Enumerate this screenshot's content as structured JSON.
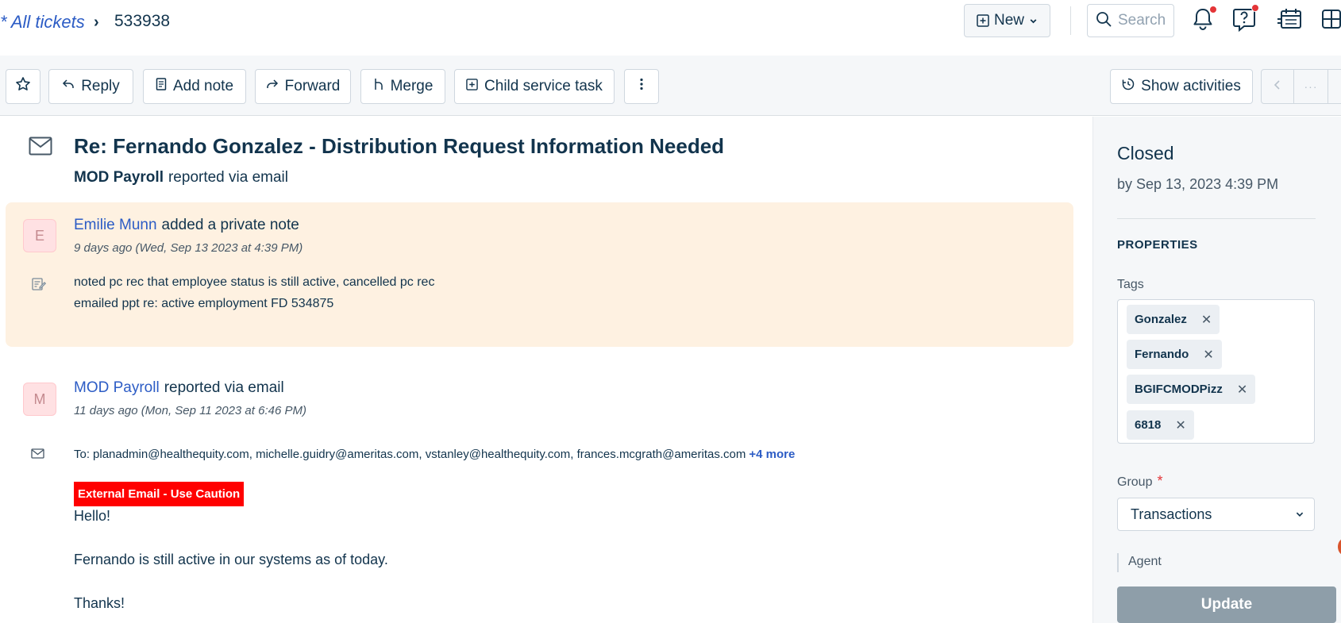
{
  "breadcrumb": {
    "all_tickets": "* All tickets",
    "separator": "›",
    "ticket_id": "533938"
  },
  "header": {
    "new_label": "New",
    "search_placeholder": "Search",
    "icons": [
      "plus-square-icon",
      "chevron-down-icon",
      "search-icon",
      "bell-icon",
      "help-icon",
      "calendar-icon",
      "apps-icon"
    ]
  },
  "toolbar": {
    "star_icon": "star-icon",
    "reply": "Reply",
    "add_note": "Add note",
    "forward": "Forward",
    "merge": "Merge",
    "child_task": "Child service task",
    "more_icon": "more-vertical-icon",
    "show_activities": "Show activities",
    "prev_icon": "chevron-left-icon",
    "ellipsis": "···"
  },
  "ticket": {
    "subject": "Re: Fernando Gonzalez - Distribution Request Information Needed",
    "reporter_name": "MOD Payroll",
    "reporter_suffix": "reported via email"
  },
  "note": {
    "avatar": "E",
    "author": "Emilie Munn",
    "action": "added a private note",
    "timestamp": "9 days ago (Wed, Sep 13 2023 at 4:39 PM)",
    "lines": [
      "noted pc rec that employee status is still active, cancelled pc rec",
      "emailed ppt re: active employment FD 534875"
    ]
  },
  "email": {
    "avatar": "M",
    "author": "MOD Payroll",
    "action": "reported via email",
    "timestamp": "11 days ago (Mon, Sep 11 2023 at 6:46 PM)",
    "to_label": "To:",
    "to_list": "planadmin@healthequity.com, michelle.guidry@ameritas.com, vstanley@healthequity.com, frances.mcgrath@ameritas.com",
    "more": "+4 more",
    "caution": "External Email - Use Caution",
    "lines": [
      "Hello!",
      "Fernando is still active in our systems as of today.",
      "Thanks!"
    ]
  },
  "panel": {
    "status": "Closed",
    "status_by": "by Sep 13, 2023 4:39 PM",
    "properties": "PROPERTIES",
    "tags_label": "Tags",
    "tags": [
      "Gonzalez",
      "Fernando",
      "BGIFCMODPizz",
      "6818"
    ],
    "group_label": "Group",
    "required": "*",
    "group_value": "Transactions",
    "agent_label": "Agent",
    "update": "Update"
  },
  "colors": {
    "link": "#2c5cc5",
    "text": "#12344d",
    "note_bg": "#fef1e1",
    "caution_bg": "#ff0000",
    "update_bg": "#8e9ea9",
    "notification_dot": "#e43538"
  }
}
